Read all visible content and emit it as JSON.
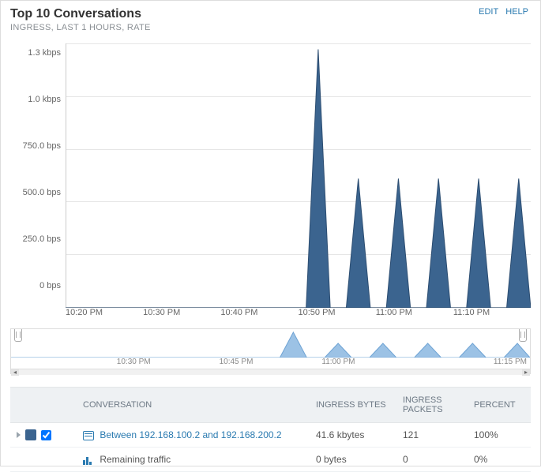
{
  "header": {
    "title": "Top 10 Conversations",
    "subtitle": "INGRESS, LAST 1 HOURS, RATE",
    "edit": "EDIT",
    "help": "HELP"
  },
  "chart_data": {
    "type": "area",
    "xlabel": "",
    "ylabel": "",
    "ylim": [
      0,
      1500
    ],
    "y_ticks": [
      "1.3 kbps",
      "1.0 kbps",
      "750.0 bps",
      "500.0 bps",
      "250.0 bps",
      "0 bps"
    ],
    "x_ticks": [
      "10:20 PM",
      "10:30 PM",
      "10:40 PM",
      "10:50 PM",
      "11:00 PM",
      "11:10 PM"
    ],
    "series": [
      {
        "name": "Between 192.168.100.2 and 192.168.200.2",
        "color": "#3b648f",
        "x_minutes_from_start": [
          0,
          5,
          10,
          15,
          20,
          25,
          30,
          31.5,
          33,
          35,
          36.5,
          38,
          40,
          41.5,
          43,
          45,
          46.5,
          48,
          50,
          51.5,
          53,
          55,
          56.5,
          58
        ],
        "values_bps": [
          0,
          0,
          0,
          0,
          0,
          0,
          0,
          1450,
          0,
          0,
          730,
          0,
          0,
          730,
          0,
          0,
          730,
          0,
          0,
          730,
          0,
          0,
          730,
          0
        ]
      }
    ]
  },
  "mini": {
    "ticks": [
      "10:30 PM",
      "10:45 PM",
      "11:00 PM",
      "11:15 PM"
    ]
  },
  "table": {
    "headers": {
      "conv": "CONVERSATION",
      "bytes": "INGRESS BYTES",
      "packets": "INGRESS PACKETS",
      "percent": "PERCENT"
    },
    "rows": [
      {
        "label": "Between 192.168.100.2 and 192.168.200.2",
        "bytes": "41.6 kbytes",
        "packets": "121",
        "percent": "100%",
        "link": true,
        "checked": true
      },
      {
        "label": "Remaining traffic",
        "bytes": "0 bytes",
        "packets": "0",
        "percent": "0%",
        "link": false
      }
    ]
  }
}
